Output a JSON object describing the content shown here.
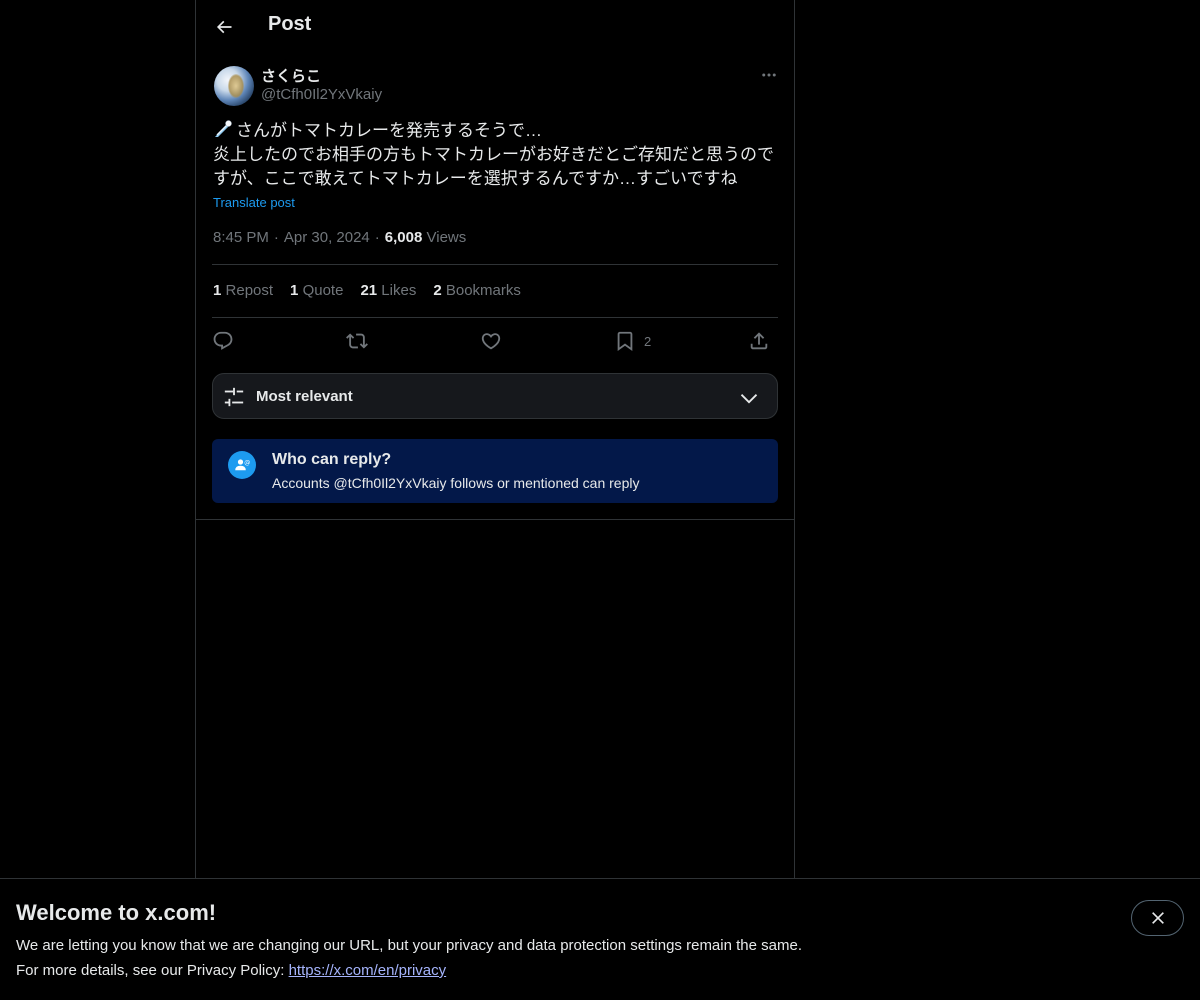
{
  "header": {
    "title": "Post"
  },
  "post": {
    "display_name": "さくらこ",
    "handle": "@tCfh0Il2YxVkaiy",
    "text": "さんがトマトカレーを発売するそうで…\n炎上したのでお相手の方もトマトカレーがお好きだとご存知だと思うのですが、ここで敢えてトマトカレーを選択するんですか…すごいですね",
    "translate_label": "Translate post",
    "time": "8:45 PM",
    "date": "Apr 30, 2024",
    "views_count": "6,008",
    "views_label": "Views"
  },
  "stats": {
    "reposts_count": "1",
    "reposts_label": "Repost",
    "quotes_count": "1",
    "quotes_label": "Quote",
    "likes_count": "21",
    "likes_label": "Likes",
    "bookmarks_count": "2",
    "bookmarks_label": "Bookmarks"
  },
  "actions": {
    "bookmark_count": "2",
    "icons": [
      "reply-icon",
      "repost-icon",
      "like-icon",
      "bookmark-icon",
      "share-icon"
    ]
  },
  "sort": {
    "label": "Most relevant"
  },
  "reply_restriction": {
    "title": "Who can reply?",
    "subtitle": "Accounts @tCfh0Il2YxVkaiy follows or mentioned can reply"
  },
  "banner": {
    "title": "Welcome to x.com!",
    "line1": "We are letting you know that we are changing our URL, but your privacy and data protection settings remain the same.",
    "line2_prefix": "For more details, see our Privacy Policy: ",
    "link": "https://x.com/en/privacy"
  },
  "colors": {
    "background": "#000000",
    "text_primary": "#e7e9ea",
    "text_secondary": "#71767b",
    "accent": "#1d9bf0",
    "reply_box_bg": "#031849",
    "border": "#2f3336"
  }
}
